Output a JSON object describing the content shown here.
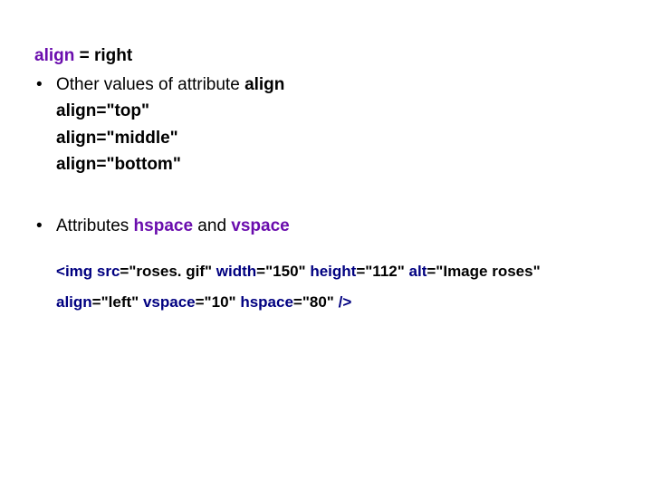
{
  "line1": {
    "align_word": "align",
    "rest": " = right"
  },
  "bullet1": {
    "prefix": "Other values of attribute ",
    "align_word": "align"
  },
  "examples": {
    "top_attr": "align",
    "top_val": "=\"top\"",
    "mid_attr": "align",
    "mid_val": "=\"middle\"",
    "bot_attr": "align",
    "bot_val": "=\"bottom\""
  },
  "bullet2": {
    "prefix": "Attributes  ",
    "hspace": "hspace",
    "mid": " and  ",
    "vspace": "vspace"
  },
  "code": {
    "lt": "<",
    "img": "img",
    "src_attr": " src",
    "src_val": "=\"roses. gif\" ",
    "width_attr": "width",
    "width_val": "=\"150\" ",
    "height_attr": "height",
    "height_val": "=\"112\" ",
    "alt_attr": "alt",
    "alt_val": "=\"Image roses\"",
    "align_attr": "align",
    "align_val": "=\"left\" ",
    "vspace_attr": "vspace",
    "vspace_val": "=\"10\" ",
    "hspace_attr": "hspace",
    "hspace_val": "=\"80\" ",
    "close": "/>"
  }
}
